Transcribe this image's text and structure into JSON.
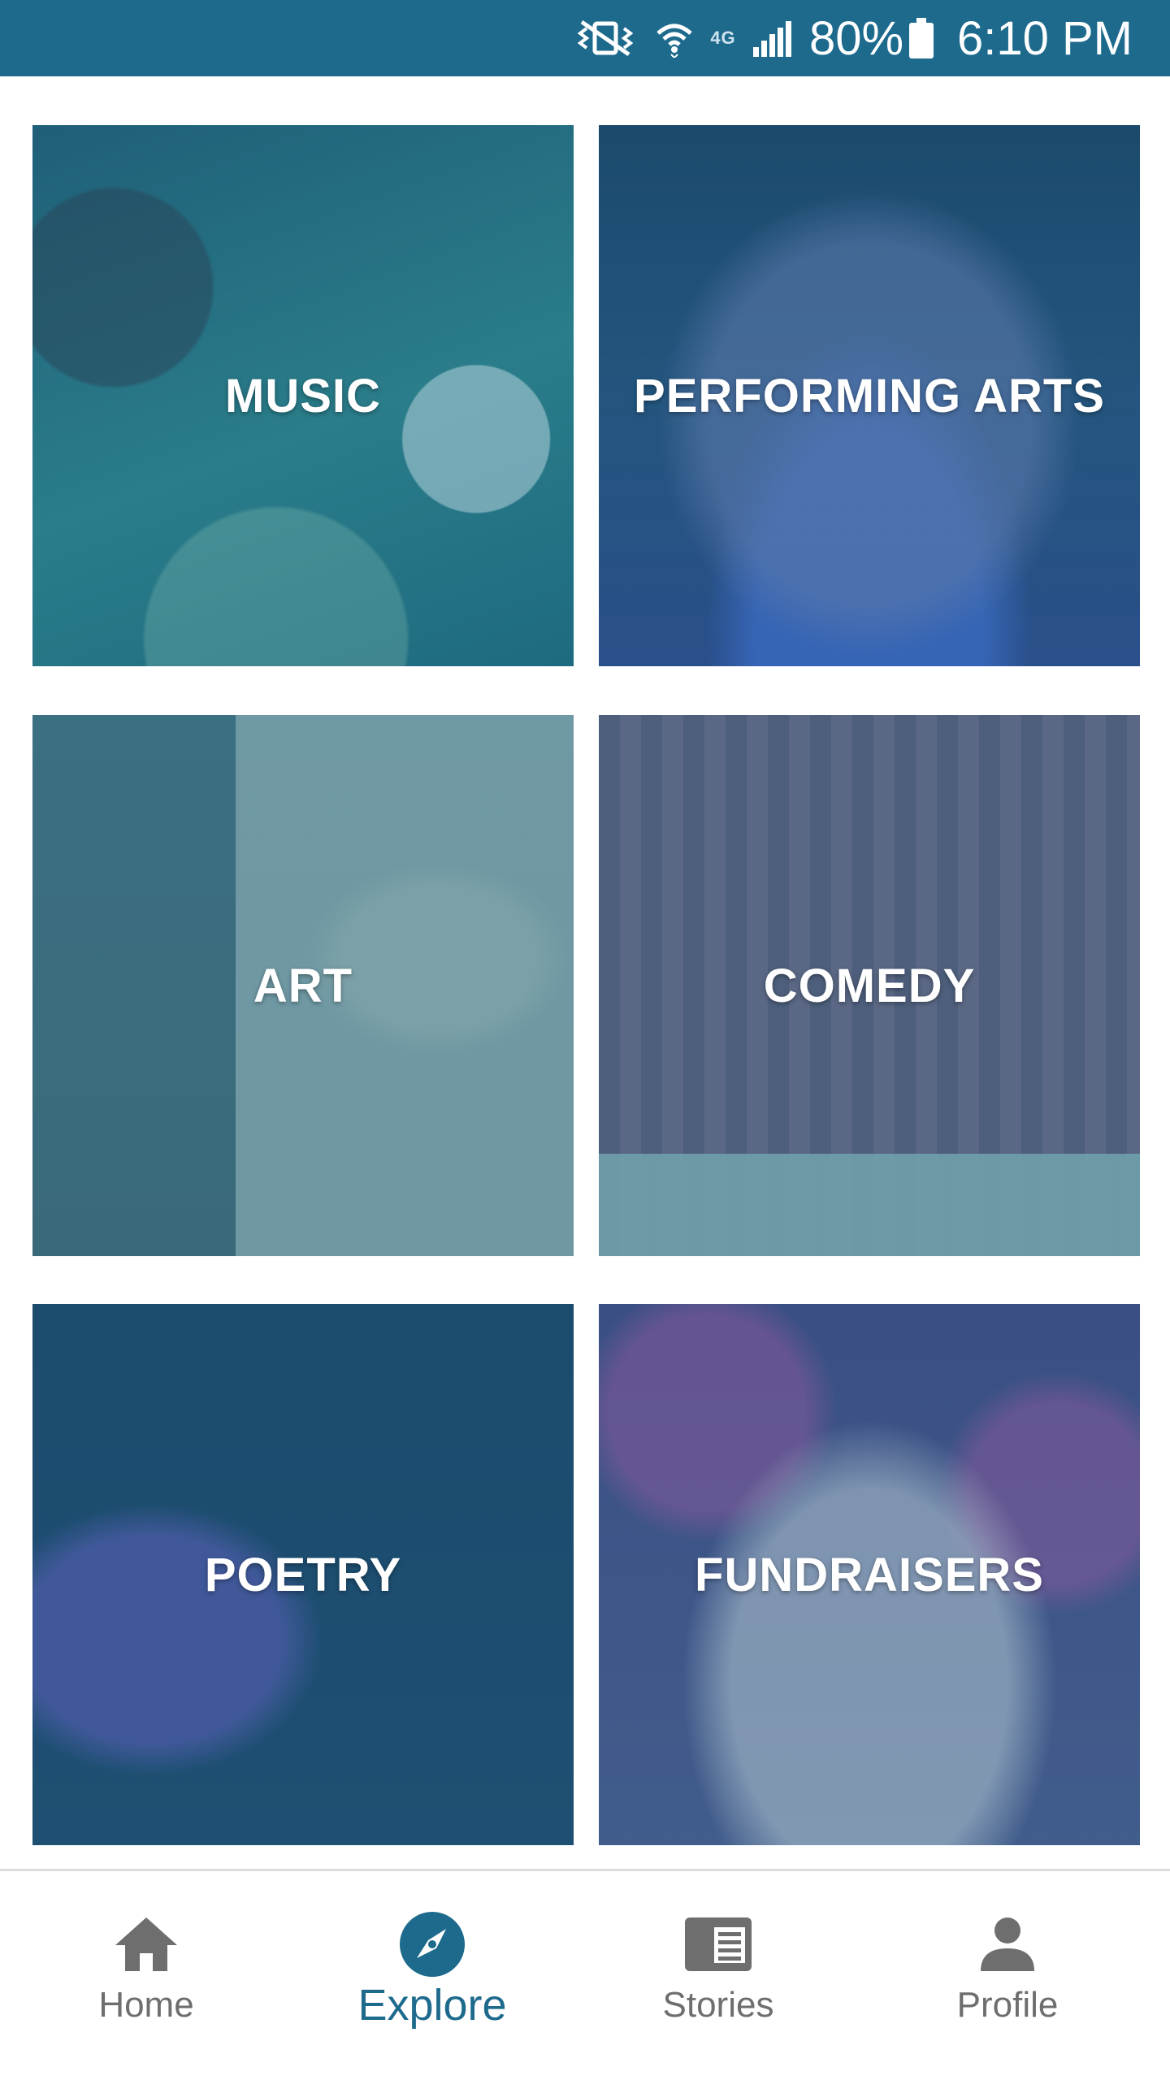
{
  "status_bar": {
    "network_type": "4G",
    "battery_percent": "80%",
    "time": "6:10 PM",
    "icons": [
      "vibrate-icon",
      "wifi-icon",
      "lte-icon",
      "signal-icon",
      "battery-icon"
    ],
    "background_color": "#1d6a8d"
  },
  "categories": [
    {
      "label": "MUSIC"
    },
    {
      "label": "PERFORMING ARTS"
    },
    {
      "label": "ART"
    },
    {
      "label": "COMEDY"
    },
    {
      "label": "POETRY"
    },
    {
      "label": "FUNDRAISERS"
    }
  ],
  "bottom_nav": {
    "active": "Explore",
    "accent_color": "#1d6a8d",
    "inactive_color": "#6e6e6e",
    "items": [
      {
        "label": "Home",
        "icon": "home-icon"
      },
      {
        "label": "Explore",
        "icon": "compass-icon"
      },
      {
        "label": "Stories",
        "icon": "stories-icon"
      },
      {
        "label": "Profile",
        "icon": "profile-icon"
      }
    ]
  }
}
